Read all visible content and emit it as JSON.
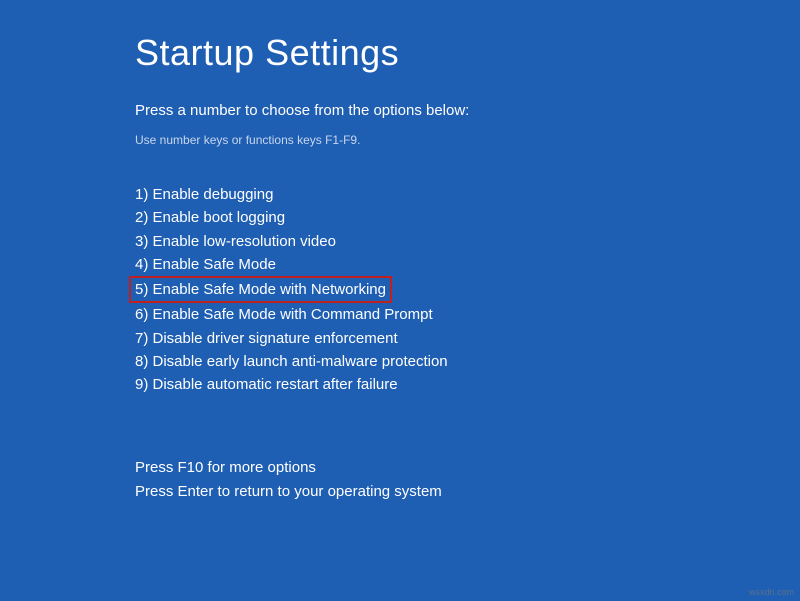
{
  "title": "Startup Settings",
  "subtitle": "Press a number to choose from the options below:",
  "hint": "Use number keys or functions keys F1-F9.",
  "options": [
    {
      "label": "1) Enable debugging",
      "highlighted": false
    },
    {
      "label": "2) Enable boot logging",
      "highlighted": false
    },
    {
      "label": "3) Enable low-resolution video",
      "highlighted": false
    },
    {
      "label": "4) Enable Safe Mode",
      "highlighted": false
    },
    {
      "label": "5) Enable Safe Mode with Networking",
      "highlighted": true
    },
    {
      "label": "6) Enable Safe Mode with Command Prompt",
      "highlighted": false
    },
    {
      "label": "7) Disable driver signature enforcement",
      "highlighted": false
    },
    {
      "label": "8) Disable early launch anti-malware protection",
      "highlighted": false
    },
    {
      "label": "9) Disable automatic restart after failure",
      "highlighted": false
    }
  ],
  "footer": {
    "line1": "Press F10 for more options",
    "line2": "Press Enter to return to your operating system"
  },
  "watermark": "wsxdn.com"
}
